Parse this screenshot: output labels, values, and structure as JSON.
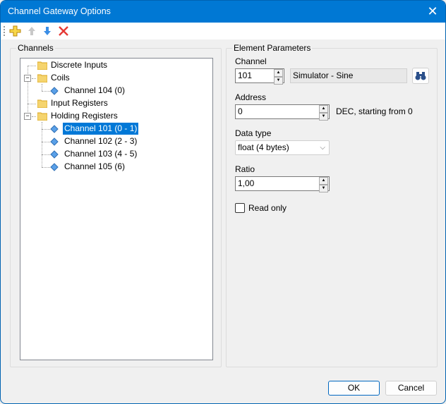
{
  "window": {
    "title": "Channel Gateway Options",
    "close_icon": "close-icon"
  },
  "toolbar": {
    "buttons": [
      {
        "name": "add",
        "icon": "plus-icon"
      },
      {
        "name": "move-up",
        "icon": "arrow-up-icon"
      },
      {
        "name": "move-down",
        "icon": "arrow-down-icon"
      },
      {
        "name": "delete",
        "icon": "delete-x-icon"
      }
    ]
  },
  "channels": {
    "group_title": "Channels",
    "tree": [
      {
        "label": "Discrete Inputs",
        "type": "folder",
        "level": 0
      },
      {
        "label": "Coils",
        "type": "folder",
        "level": 0,
        "expanded": true
      },
      {
        "label": "Channel 104 (0)",
        "type": "channel",
        "level": 1
      },
      {
        "label": "Input Registers",
        "type": "folder",
        "level": 0
      },
      {
        "label": "Holding Registers",
        "type": "folder",
        "level": 0,
        "expanded": true
      },
      {
        "label": "Channel 101 (0 - 1)",
        "type": "channel",
        "level": 1,
        "selected": true
      },
      {
        "label": "Channel 102 (2 - 3)",
        "type": "channel",
        "level": 1
      },
      {
        "label": "Channel 103 (4 - 5)",
        "type": "channel",
        "level": 1
      },
      {
        "label": "Channel 105 (6)",
        "type": "channel",
        "level": 1
      }
    ]
  },
  "params": {
    "group_title": "Element Parameters",
    "channel_label": "Channel",
    "channel_value": "101",
    "channel_name": "Simulator - Sine",
    "browse_icon": "binoculars-icon",
    "address_label": "Address",
    "address_value": "0",
    "address_hint": "DEC, starting from 0",
    "datatype_label": "Data type",
    "datatype_value": "float (4 bytes)",
    "ratio_label": "Ratio",
    "ratio_value": "1,00",
    "readonly_label": "Read only",
    "readonly_checked": false
  },
  "footer": {
    "ok_label": "OK",
    "cancel_label": "Cancel"
  }
}
